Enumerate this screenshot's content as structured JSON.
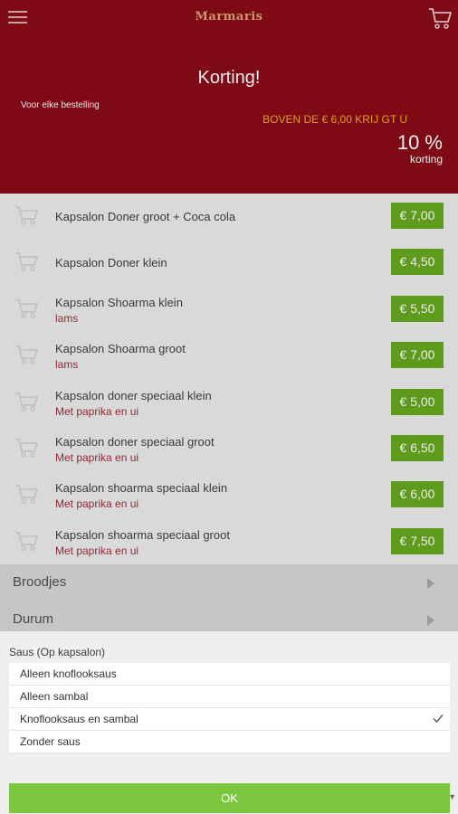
{
  "app": {
    "brand": "Marmaris"
  },
  "header": {
    "title": "Korting!",
    "subtitle": "Voor elke bestelling",
    "offer": "BOVEN DE € 6,00 KRIJ GT U",
    "percent": "10 %",
    "percent_label": "korting"
  },
  "items": [
    {
      "name": "Kapsalon Doner groot + Coca cola",
      "sub": "",
      "price": "€ 7,00"
    },
    {
      "name": "Kapsalon Doner klein",
      "sub": "",
      "price": "€ 4,50"
    },
    {
      "name": "Kapsalon Shoarma klein",
      "sub": "lams",
      "price": "€ 5,50"
    },
    {
      "name": "Kapsalon Shoarma groot",
      "sub": "lams",
      "price": "€ 7,00"
    },
    {
      "name": "Kapsalon doner speciaal klein",
      "sub": "Met paprika en ui",
      "price": "€ 5,00"
    },
    {
      "name": "Kapsalon doner speciaal groot",
      "sub": "Met paprika en ui",
      "price": "€ 6,50"
    },
    {
      "name": "Kapsalon shoarma speciaal klein",
      "sub": "Met paprika en ui",
      "price": "€ 6,00"
    },
    {
      "name": "Kapsalon shoarma speciaal groot",
      "sub": "Met paprika en ui",
      "price": "€ 7,50"
    }
  ],
  "categories": [
    {
      "label": "Broodjes"
    },
    {
      "label": "Durum"
    }
  ],
  "sheet": {
    "title": "Saus (Op kapsalon)",
    "options": [
      {
        "label": "Alleen knoflooksaus",
        "selected": false
      },
      {
        "label": "Alleen sambal",
        "selected": false
      },
      {
        "label": "Knoflooksaus en sambal",
        "selected": true
      },
      {
        "label": "Zonder saus",
        "selected": false
      }
    ],
    "ok_label": "OK"
  },
  "colors": {
    "header_bg": "#7e0a16",
    "price_bg": "#5e9a1c",
    "ok_bg": "#7cc53e",
    "offer_text": "#d9a028",
    "sub_text": "#8e2a34"
  }
}
